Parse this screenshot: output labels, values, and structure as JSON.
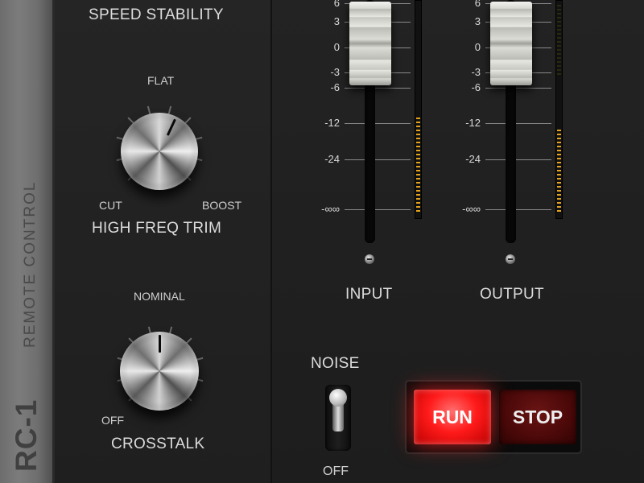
{
  "side_strip": {
    "model": "RC-1",
    "label": "REMOTE CONTROL"
  },
  "left_panel": {
    "speed_stability": "SPEED STABILITY",
    "high_freq_trim": {
      "title": "HIGH FREQ TRIM",
      "top": "FLAT",
      "left": "CUT",
      "right": "BOOST"
    },
    "crosstalk": {
      "title": "CROSSTALK",
      "top": "NOMINAL",
      "left": "OFF"
    }
  },
  "faders": {
    "scale": [
      "6",
      "3",
      "0",
      "-3",
      "-6",
      "-12",
      "-24",
      "-∞∞"
    ],
    "input_label": "INPUT",
    "output_label": "OUTPUT"
  },
  "noise": {
    "top": "NOISE",
    "bottom": "OFF"
  },
  "transport": {
    "run": "RUN",
    "stop": "STOP"
  },
  "colors": {
    "run_active": "#ff1a1a",
    "stop": "#4a0808",
    "meter_led": "#e6a21a"
  }
}
